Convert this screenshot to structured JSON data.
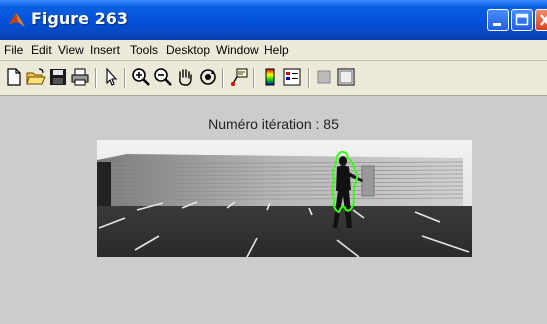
{
  "window": {
    "title": "Figure 263",
    "icons": {
      "logo": "matlab-logo-icon",
      "minimize": "minimize-icon",
      "maximize": "maximize-icon",
      "close": "close-icon"
    }
  },
  "menu": {
    "items": [
      {
        "label": "File"
      },
      {
        "label": "Edit"
      },
      {
        "label": "View"
      },
      {
        "label": "Insert"
      },
      {
        "label": "Tools"
      },
      {
        "label": "Desktop"
      },
      {
        "label": "Window"
      },
      {
        "label": "Help"
      }
    ]
  },
  "toolbar": {
    "icons": [
      "new-figure-icon",
      "open-file-icon",
      "save-icon",
      "print-icon",
      "select-arrow-icon",
      "zoom-in-icon",
      "zoom-out-icon",
      "pan-hand-icon",
      "rotate-3d-icon",
      "data-cursor-icon",
      "insert-colorbar-icon",
      "insert-legend-icon",
      "hide-plot-tools-icon",
      "show-plot-tools-icon"
    ]
  },
  "plot": {
    "title": "Numéro itération :  85",
    "image": {
      "name": "tracking-frame",
      "contour_color": "#39ff14"
    }
  }
}
